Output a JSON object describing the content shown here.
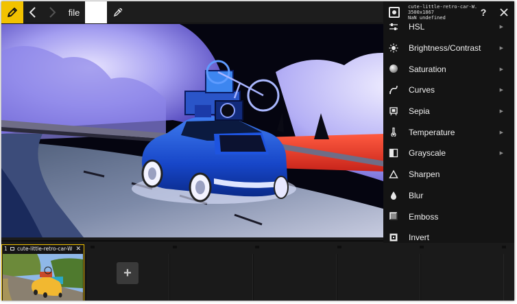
{
  "toolbar": {
    "file_label": "file",
    "swatch_color": "#ffffff",
    "accent_color": "#f2c200",
    "icons": [
      "pencil-icon",
      "back-arrow-icon",
      "forward-arrow-icon",
      "eyedropper-icon"
    ]
  },
  "panel": {
    "file_name": "cute-little-retro-car-W...",
    "dimensions": "3500x1867",
    "info": "NaN undefined",
    "help_label": "?",
    "menu": [
      {
        "label": "HSL",
        "icon": "sliders-icon",
        "submenu": true
      },
      {
        "label": "Brightness/Contrast",
        "icon": "sun-icon",
        "submenu": true
      },
      {
        "label": "Saturation",
        "icon": "saturation-ball-icon",
        "submenu": true
      },
      {
        "label": "Curves",
        "icon": "curves-icon",
        "submenu": true
      },
      {
        "label": "Sepia",
        "icon": "sepia-icon",
        "submenu": true
      },
      {
        "label": "Temperature",
        "icon": "thermometer-icon",
        "submenu": true
      },
      {
        "label": "Grayscale",
        "icon": "grayscale-icon",
        "submenu": true
      },
      {
        "label": "Sharpen",
        "icon": "triangle-icon",
        "submenu": false
      },
      {
        "label": "Blur",
        "icon": "droplet-icon",
        "submenu": false
      },
      {
        "label": "Emboss",
        "icon": "emboss-icon",
        "submenu": false
      },
      {
        "label": "Invert",
        "icon": "invert-icon",
        "submenu": false
      }
    ]
  },
  "filmstrip": {
    "thumb_number": "1",
    "thumb_title": "cute-little-retro-car-W...",
    "thumb_close": "✕",
    "add_label": "+"
  }
}
